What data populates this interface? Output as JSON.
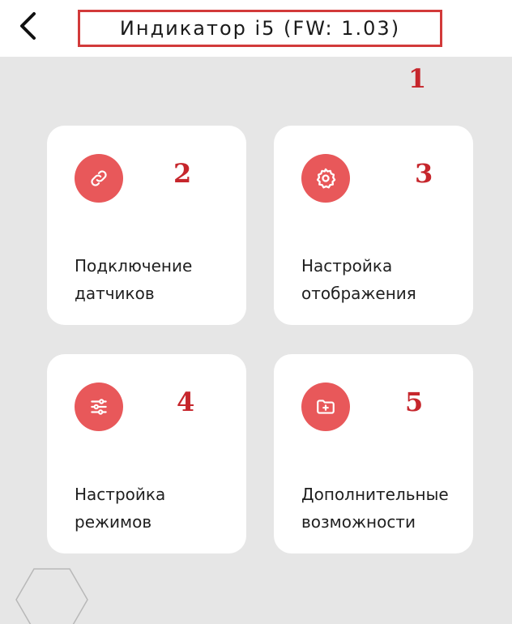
{
  "header": {
    "title": "Индикатор i5 (FW: 1.03)",
    "back_icon": "chevron-left-icon"
  },
  "annotations": [
    "1",
    "2",
    "3",
    "4",
    "5"
  ],
  "cards": [
    {
      "icon": "link-icon",
      "line1": "Подключение",
      "line2": "датчиков"
    },
    {
      "icon": "gear-icon",
      "line1": "Настройка",
      "line2": "отображения"
    },
    {
      "icon": "sliders-icon",
      "line1": "Настройка",
      "line2": "режимов"
    },
    {
      "icon": "folder-plus-icon",
      "line1": "Дополнительные",
      "line2": "возможности"
    }
  ],
  "colors": {
    "accent": "#e8585a",
    "annotation": "#c6262c",
    "background": "#e6e6e6",
    "card": "#ffffff"
  }
}
